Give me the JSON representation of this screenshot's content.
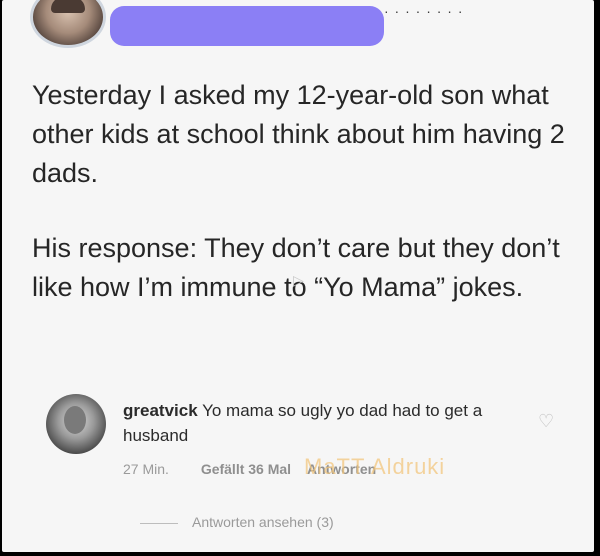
{
  "post": {
    "paragraph1": "Yesterday I asked my 12-year-old son what other kids at school think about him having 2 dads.",
    "paragraph2": "His response: They don’t care but they don’t like how I’m immune to “Yo Mama” jokes."
  },
  "comment": {
    "username": "greatvick",
    "text": "Yo mama so ugly yo dad had to get a husband",
    "time": "27 Min.",
    "likes": "Gefällt 36 Mal",
    "reply": "Antworten",
    "view_replies": "Antworten ansehen (3)"
  },
  "watermark": "MaTT Aldruki",
  "icons": {
    "heart": "heart-icon",
    "play": "play-icon"
  },
  "colors": {
    "redaction": "#8b7ff5",
    "background": "#f6f6f6",
    "text": "#262626",
    "muted": "#9a9a9a",
    "watermark": "#f3c77e"
  }
}
